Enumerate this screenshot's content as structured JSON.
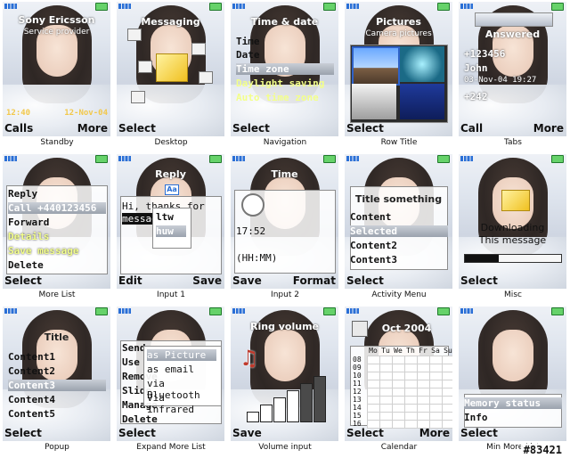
{
  "screens": [
    {
      "id": "standby",
      "caption": "Standby",
      "soft_left": "Calls",
      "soft_right": "More",
      "texts": {
        "brand": "Sony Ericsson",
        "provider": "Service provider",
        "time": "12:40",
        "date": "12-Nov-04"
      }
    },
    {
      "id": "desktop",
      "caption": "Desktop",
      "soft_left": "Select",
      "soft_right": "",
      "texts": {
        "title": "Messaging"
      }
    },
    {
      "id": "navigation",
      "caption": "Navigation",
      "soft_left": "Select",
      "soft_right": "",
      "texts": {
        "title": "Time & date",
        "items": [
          "Time",
          "Date",
          "Time zone",
          "Daylight saving",
          "Auto time zone"
        ],
        "selected_index": 2
      }
    },
    {
      "id": "row-title",
      "caption": "Row Title",
      "soft_left": "Select",
      "soft_right": "",
      "texts": {
        "title": "Pictures",
        "subtitle": "Camera pictures"
      }
    },
    {
      "id": "tabs",
      "caption": "Tabs",
      "soft_left": "Call",
      "soft_right": "More",
      "texts": {
        "title": "Answered",
        "rows": [
          "+123456",
          "John",
          "03-Nov-04 19:27",
          "+242"
        ]
      }
    },
    {
      "id": "more-list",
      "caption": "More List",
      "soft_left": "Select",
      "soft_right": "",
      "texts": {
        "items": [
          "Reply",
          "Call +440123456",
          "Forward",
          "Details",
          "Save message",
          "Delete"
        ],
        "selected_index": 1
      }
    },
    {
      "id": "input1",
      "caption": "Input 1",
      "soft_left": "Edit",
      "soft_right": "Save",
      "texts": {
        "title": "Reply",
        "mode": "Aa",
        "line1": "Hi, thanks for your",
        "line2": "message",
        "suggestions": [
          "ltw",
          "huw"
        ]
      }
    },
    {
      "id": "input2",
      "caption": "Input 2",
      "soft_left": "Save",
      "soft_right": "Format",
      "texts": {
        "title": "Time",
        "time": "17:52",
        "format": "(HH:MM)"
      }
    },
    {
      "id": "activity-menu",
      "caption": "Activity Menu",
      "soft_left": "Select",
      "soft_right": "",
      "texts": {
        "title": "Title something",
        "items": [
          "Content",
          "Selected",
          "Content2",
          "Content3"
        ],
        "selected_index": 1
      }
    },
    {
      "id": "misc",
      "caption": "Misc",
      "soft_left": "Select",
      "soft_right": "",
      "texts": {
        "line1": "Downloading",
        "line2": "This message",
        "progress": 0.35
      }
    },
    {
      "id": "popup",
      "caption": "Popup",
      "soft_left": "Select",
      "soft_right": "",
      "texts": {
        "title": "Title",
        "items": [
          "Content1",
          "Content2",
          "Content3",
          "Content4",
          "Content5"
        ],
        "selected_index": 2
      }
    },
    {
      "id": "expand-more-list",
      "caption": "Expand More List",
      "soft_left": "Select",
      "soft_right": "",
      "texts": {
        "items": [
          "Send",
          "Use",
          "Remove",
          "Slide",
          "Manage",
          "Delete"
        ],
        "sub_items": [
          "as Picture msg",
          "as email",
          "via Bluetooth",
          "Via infrared"
        ],
        "sub_selected_index": 0
      }
    },
    {
      "id": "volume-input",
      "caption": "Volume input",
      "soft_left": "Save",
      "soft_right": "",
      "texts": {
        "title": "Ring volume",
        "level": 4,
        "max": 6
      }
    },
    {
      "id": "calendar",
      "caption": "Calendar",
      "soft_left": "Select",
      "soft_right": "More",
      "texts": {
        "title": "Oct 2004",
        "days": [
          "Mo",
          "Tu",
          "We",
          "Th",
          "Fr",
          "Sa",
          "Su"
        ],
        "hours": [
          "08",
          "09",
          "10",
          "11",
          "12",
          "13",
          "14",
          "15",
          "16"
        ]
      }
    },
    {
      "id": "min-more-list",
      "caption": "Min More List",
      "soft_left": "Select",
      "soft_right": "",
      "texts": {
        "items": [
          "Memory status",
          "Info"
        ],
        "selected_index": 0
      }
    }
  ],
  "watermark": "#83421"
}
